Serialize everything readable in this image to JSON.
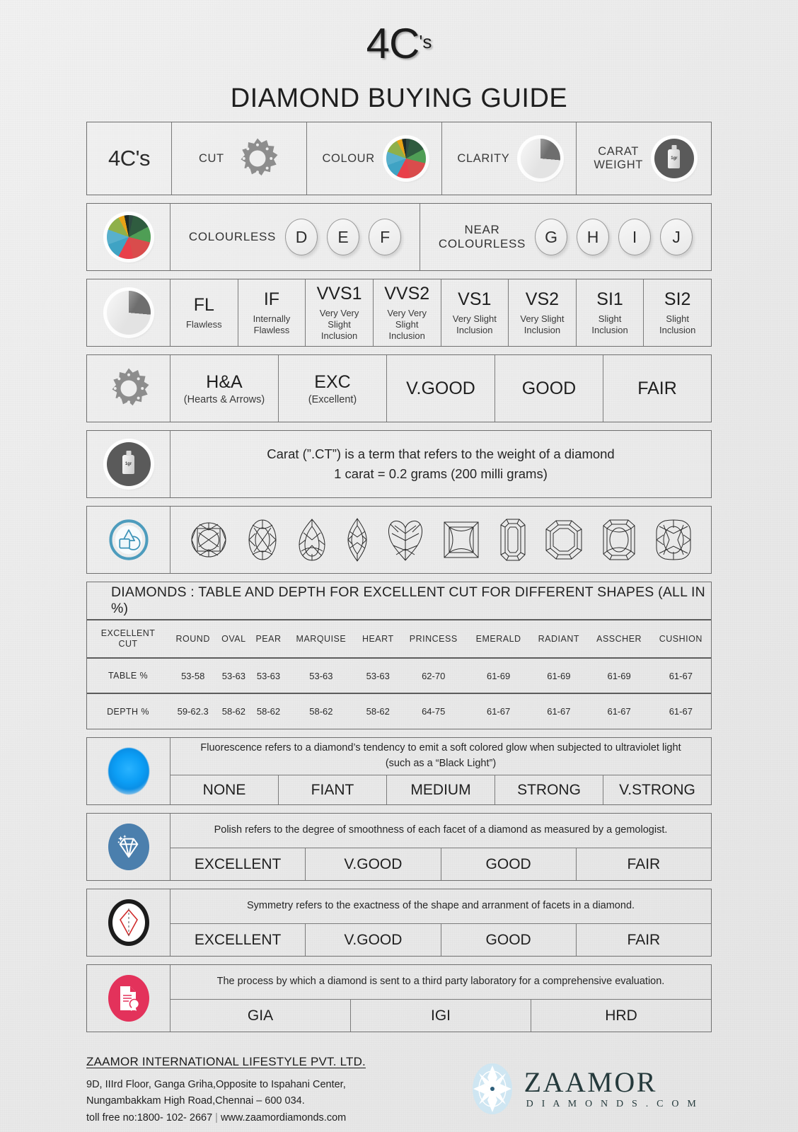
{
  "header": {
    "title_main": "4C",
    "title_suffix": "'s",
    "title_sub": "DIAMOND BUYING GUIDE"
  },
  "row_4c": {
    "label": "4C's",
    "items": [
      {
        "label": "CUT",
        "icon": "cut-saw-icon"
      },
      {
        "label": "COLOUR",
        "icon": "colour-wheel-icon"
      },
      {
        "label": "CLARITY",
        "icon": "clarity-pie-icon"
      },
      {
        "label": "CARAT WEIGHT",
        "label_line1": "CARAT",
        "label_line2": "WEIGHT",
        "icon": "carat-bottle-icon"
      }
    ]
  },
  "colour_row": {
    "icon": "colour-wheel-icon",
    "groups": [
      {
        "label": "COLOURLESS",
        "label_line1": "COLOURLESS",
        "label_line2": "",
        "grades": [
          "D",
          "E",
          "F"
        ]
      },
      {
        "label": "NEAR COLOURLESS",
        "label_line1": "NEAR",
        "label_line2": "COLOURLESS",
        "grades": [
          "G",
          "H",
          "I",
          "J"
        ]
      }
    ]
  },
  "clarity_row": {
    "icon": "clarity-pie-icon",
    "items": [
      {
        "code": "FL",
        "desc": "Flawless"
      },
      {
        "code": "IF",
        "desc": "Internally Flawless"
      },
      {
        "code": "VVS1",
        "desc": "Very Very Slight Inclusion"
      },
      {
        "code": "VVS2",
        "desc": "Very Very Slight Inclusion"
      },
      {
        "code": "VS1",
        "desc": "Very Slight Inclusion"
      },
      {
        "code": "VS2",
        "desc": "Very Slight Inclusion"
      },
      {
        "code": "SI1",
        "desc": "Slight Inclusion"
      },
      {
        "code": "SI2",
        "desc": "Slight Inclusion"
      }
    ]
  },
  "cut_row": {
    "icon": "cut-saw-icon",
    "items": [
      {
        "big": "H&A",
        "small": "(Hearts & Arrows)"
      },
      {
        "big": "EXC",
        "small": "(Excellent)"
      },
      {
        "big": "V.GOOD",
        "small": ""
      },
      {
        "big": "GOOD",
        "small": ""
      },
      {
        "big": "FAIR",
        "small": ""
      }
    ]
  },
  "carat_row": {
    "icon": "carat-bottle-icon",
    "line1": "Carat (”.CT”) is a term that refers to the weight of a diamond",
    "line2": "1 carat = 0.2 grams (200 milli grams)"
  },
  "shapes_row": {
    "icon": "shapes-icon",
    "shapes": [
      "ROUND",
      "OVAL",
      "PEAR",
      "MARQUISE",
      "HEART",
      "PRINCESS",
      "EMERALD",
      "ASSCHER",
      "RADIANT",
      "CUSHION"
    ]
  },
  "chart_data": {
    "type": "table",
    "title": "DIAMONDS : TABLE AND DEPTH FOR EXCELLENT CUT FOR DIFFERENT SHAPES (ALL IN %)",
    "corner_header_line1": "EXCELLENT",
    "corner_header_line2": "CUT",
    "categories": [
      "ROUND",
      "OVAL",
      "PEAR",
      "MARQUISE",
      "HEART",
      "PRINCESS",
      "EMERALD",
      "RADIANT",
      "ASSCHER",
      "CUSHION"
    ],
    "series": [
      {
        "name": "TABLE %",
        "values": [
          "53-58",
          "53-63",
          "53-63",
          "53-63",
          "53-63",
          "62-70",
          "61-69",
          "61-69",
          "61-69",
          "61-67"
        ]
      },
      {
        "name": "DEPTH %",
        "values": [
          "59-62.3",
          "58-62",
          "58-62",
          "58-62",
          "58-62",
          "64-75",
          "61-67",
          "61-67",
          "61-67",
          "61-67"
        ]
      }
    ]
  },
  "fluorescence": {
    "icon": "fluorescence-glow-icon",
    "desc": "Fluorescence refers to a diamond’s tendency to emit a soft colored glow when subjected to ultraviolet light (such as a “Black Light”)",
    "grades": [
      "NONE",
      "FIANT",
      "MEDIUM",
      "STRONG",
      "V.STRONG"
    ],
    "color": "#0c9ef5"
  },
  "polish": {
    "icon": "polish-diamond-icon",
    "desc": "Polish refers to the degree of smoothness of each facet of a diamond as measured by a gemologist.",
    "grades": [
      "EXCELLENT",
      "V.GOOD",
      "GOOD",
      "FAIR"
    ],
    "color": "#4b7fad"
  },
  "symmetry": {
    "icon": "symmetry-icon",
    "desc": "Symmetry refers to the exactness of the shape and arranment of facets in a diamond.",
    "grades": [
      "EXCELLENT",
      "V.GOOD",
      "GOOD",
      "FAIR"
    ],
    "color": "#1c1c1c"
  },
  "certification": {
    "icon": "certificate-icon",
    "desc": "The process by which a diamond is sent to a third party laboratory for a comprehensive evaluation.",
    "grades": [
      "GIA",
      "IGI",
      "HRD"
    ],
    "color": "#e3325b"
  },
  "footer": {
    "company": "ZAAMOR INTERNATIONAL LIFESTYLE PVT. LTD.",
    "address_line1": "9D, IIIrd Floor, Ganga Griha,Opposite to Ispahani  Center,",
    "address_line2": "Nungambakkam High Road,Chennai – 600 034.",
    "phone": "toll free no:1800-  102-  2667",
    "website": "www.zaamordiamonds.com",
    "logo_name": "ZAAMOR",
    "logo_tagline": "D I A M O N D S . C O M"
  }
}
